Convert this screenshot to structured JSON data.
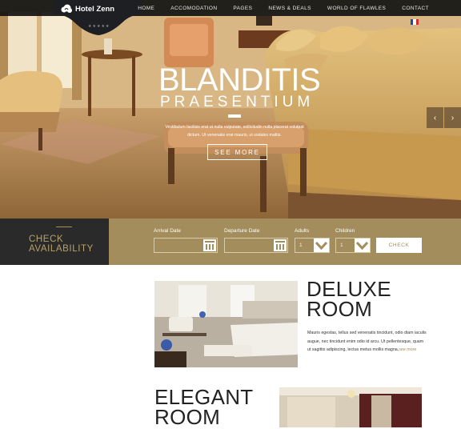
{
  "site": {
    "name": "Hotel Zenn",
    "stars": "★★★★★"
  },
  "nav": {
    "items": [
      "HOME",
      "ACCOMODATION",
      "PAGES",
      "NEWS & DEALS",
      "WORLD OF FLAWLES",
      "CONTACT"
    ]
  },
  "language": {
    "icon": "french-flag-icon"
  },
  "hero": {
    "title": "BLANDITIS",
    "subtitle": "PRAESENTIUM",
    "text": "Vestibulum facilisis erat ut nulla vulputate, sollicitudin nulla placerat volutpat dictum. Ut venenatis erat mauris, ut sodales mattis.",
    "button_label": "SEE MORE",
    "prev_label": "‹",
    "next_label": "›"
  },
  "booking": {
    "title_line1": "CHECK",
    "title_line2": "AVAILABILITY",
    "arrival_label": "Arrival Date",
    "departure_label": "Departure Date",
    "adults_label": "Adults",
    "adults_value": "1",
    "children_label": "Children",
    "children_value": "1",
    "button_label": "CHECK"
  },
  "rooms": [
    {
      "title_line1": "DELUXE",
      "title_line2": "ROOM",
      "description": "Mauris egestas, tellus sed venenatis tincidunt, odio diam iaculis augue, nec tincidunt enim odio id arcu. Ut pellentesque, quam ut sagittis adipiscing, lectus metus mollis magna,",
      "link_label": "see more"
    },
    {
      "title_line1": "ELEGANT",
      "title_line2": "ROOM"
    }
  ],
  "colors": {
    "accent": "#a38d5c",
    "dark": "#2a2a2a",
    "white": "#ffffff"
  }
}
